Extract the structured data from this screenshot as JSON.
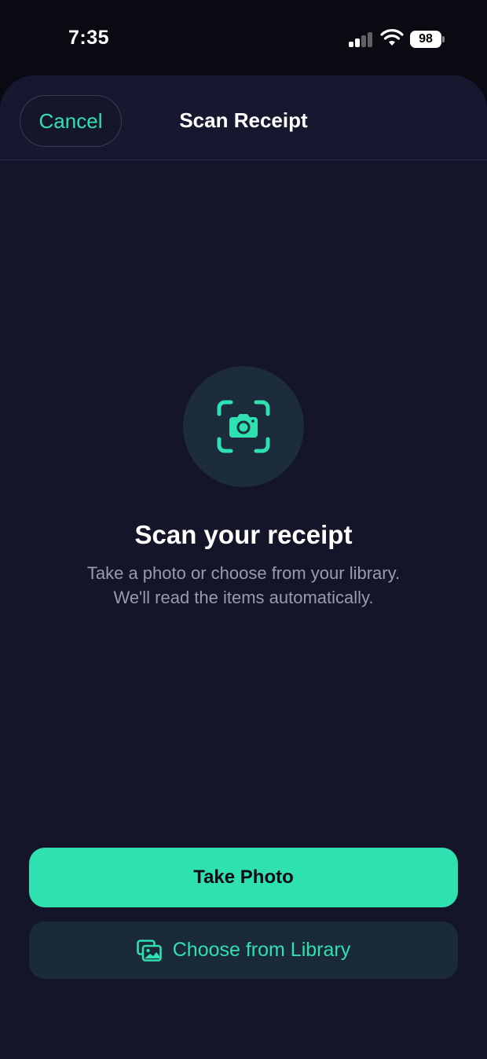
{
  "status_bar": {
    "time": "7:35",
    "battery_level": "98",
    "signal_bars_active": 2,
    "signal_bars_total": 4
  },
  "header": {
    "cancel_label": "Cancel",
    "title": "Scan Receipt"
  },
  "scan": {
    "icon": "camera-viewfinder-icon",
    "heading": "Scan your receipt",
    "subtitle_line1": "Take a photo or choose from your library.",
    "subtitle_line2": "We'll read the items automatically."
  },
  "actions": {
    "take_photo_label": "Take Photo",
    "choose_library_label": "Choose from Library",
    "choose_library_icon": "photo-library-icon"
  },
  "colors": {
    "accent": "#2fe0b1",
    "background": "#15152a",
    "icon_circle": "#1d2c3c",
    "secondary_button": "#1b2a38"
  }
}
